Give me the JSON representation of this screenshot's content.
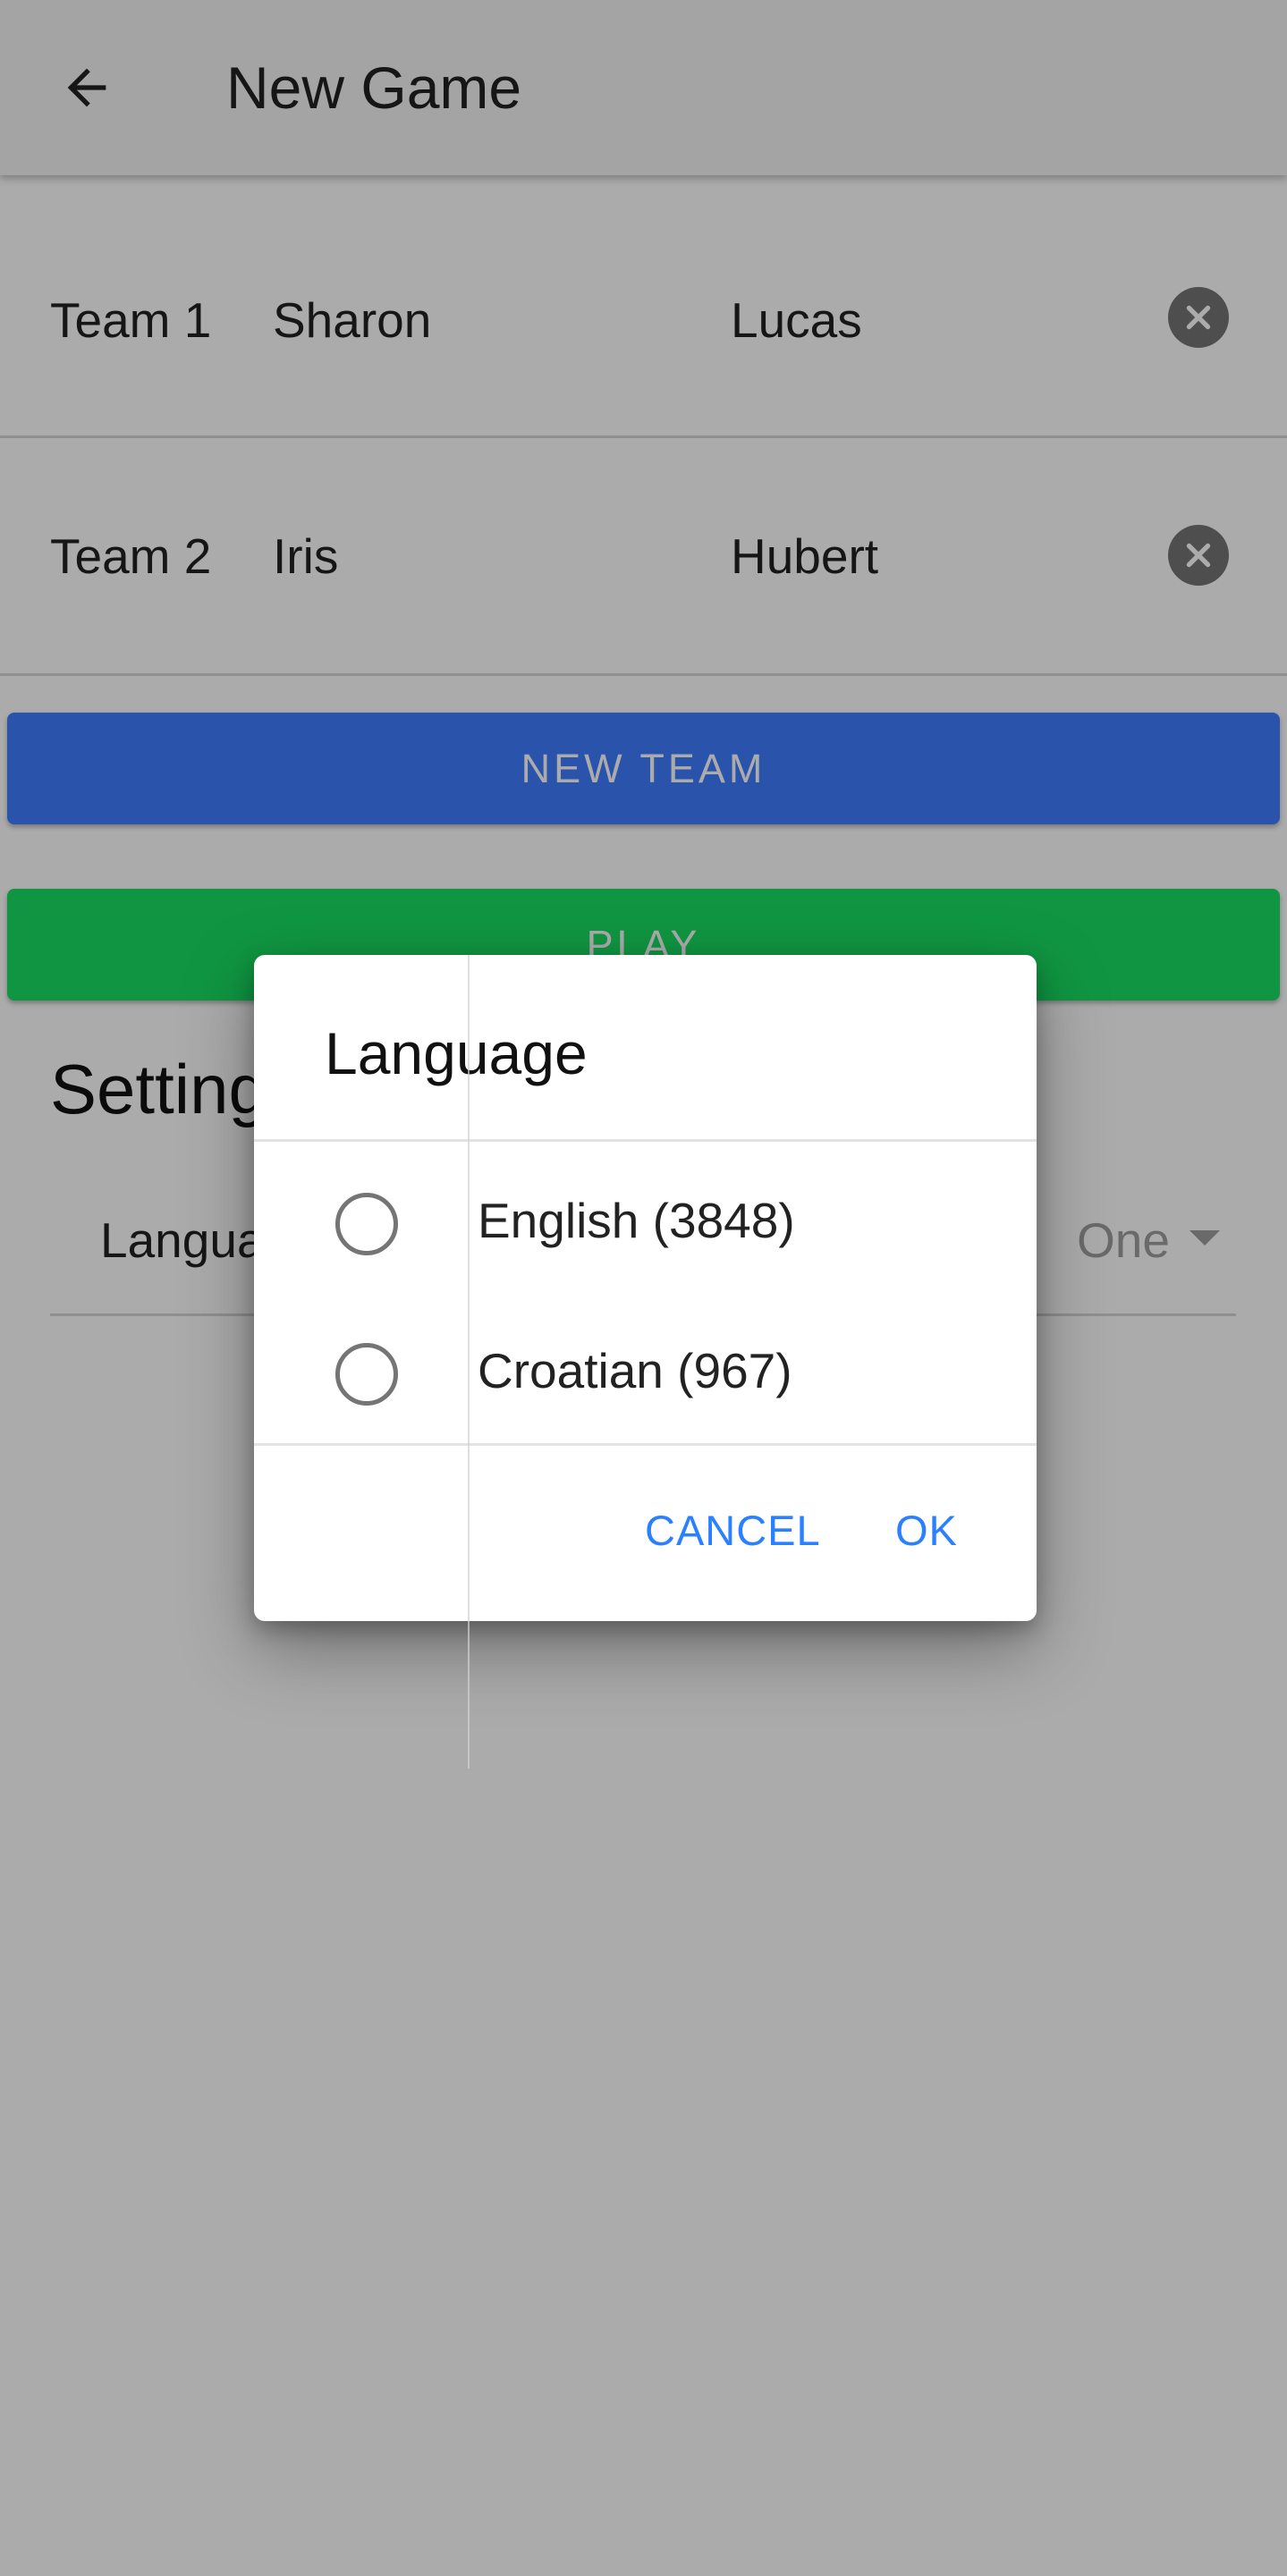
{
  "appbar": {
    "title": "New Game",
    "back_icon": "arrow-left-icon"
  },
  "teams": [
    {
      "label": "Team 1",
      "player1": "Sharon",
      "player2": "Lucas",
      "remove_icon": "close-circle-icon"
    },
    {
      "label": "Team 2",
      "player1": "Iris",
      "player2": "Hubert",
      "remove_icon": "close-circle-icon"
    }
  ],
  "buttons": {
    "new_team": "NEW TEAM",
    "play": "PLAY"
  },
  "settings": {
    "title": "Settings",
    "language_label": "Language",
    "language_value": "One"
  },
  "dialog": {
    "title": "Language",
    "options": [
      {
        "label": "English (3848)",
        "selected": false
      },
      {
        "label": "Croatian (967)",
        "selected": false
      }
    ],
    "cancel": "CANCEL",
    "ok": "OK"
  },
  "colors": {
    "primary_blue": "#3f7cff",
    "play_green": "#19e063",
    "dialog_action": "#2b80ff"
  }
}
